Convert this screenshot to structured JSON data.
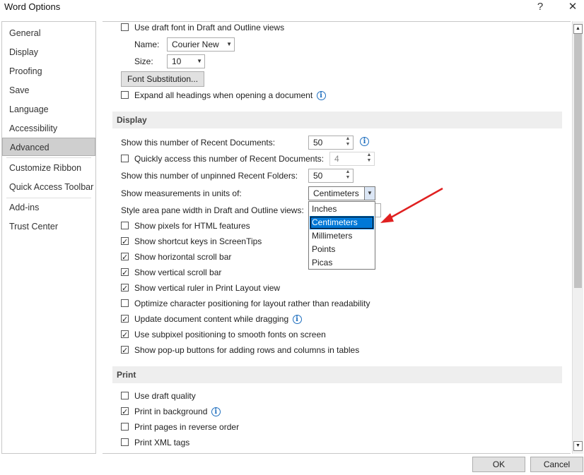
{
  "window": {
    "title": "Word Options",
    "help_label": "?",
    "close_label": "✕"
  },
  "sidebar": {
    "items": [
      {
        "label": "General"
      },
      {
        "label": "Display"
      },
      {
        "label": "Proofing"
      },
      {
        "label": "Save"
      },
      {
        "label": "Language"
      },
      {
        "label": "Accessibility"
      },
      {
        "label": "Advanced",
        "selected": true
      },
      {
        "label": "Customize Ribbon"
      },
      {
        "label": "Quick Access Toolbar"
      },
      {
        "label": "Add-ins"
      },
      {
        "label": "Trust Center"
      }
    ]
  },
  "top_options": {
    "draft_font_label": "Use draft font in Draft and Outline views",
    "name_label": "Name:",
    "name_value": "Courier New",
    "size_label": "Size:",
    "size_value": "10",
    "font_substitution_label": "Font Substitution...",
    "expand_headings_label": "Expand all headings when opening a document"
  },
  "display": {
    "header": "Display",
    "recent_docs_label": "Show this number of Recent Documents:",
    "recent_docs_value": "50",
    "quick_access_label": "Quickly access this number of Recent Documents:",
    "quick_access_value": "4",
    "unpinned_folders_label": "Show this number of unpinned Recent Folders:",
    "unpinned_folders_value": "50",
    "units_label": "Show measurements in units of:",
    "units_value": "Centimeters",
    "units_options": [
      "Inches",
      "Centimeters",
      "Millimeters",
      "Points",
      "Picas"
    ],
    "style_area_label": "Style area pane width in Draft and Outline views:",
    "checkboxes": [
      {
        "label": "Show pixels for HTML features",
        "checked": false
      },
      {
        "label": "Show shortcut keys in ScreenTips",
        "checked": true
      },
      {
        "label": "Show horizontal scroll bar",
        "checked": true
      },
      {
        "label": "Show vertical scroll bar",
        "checked": true
      },
      {
        "label": "Show vertical ruler in Print Layout view",
        "checked": true
      },
      {
        "label": "Optimize character positioning for layout rather than readability",
        "checked": false
      },
      {
        "label": "Update document content while dragging",
        "checked": true
      },
      {
        "label": "Use subpixel positioning to smooth fonts on screen",
        "checked": true
      },
      {
        "label": "Show pop-up buttons for adding rows and columns in tables",
        "checked": true
      }
    ]
  },
  "print": {
    "header": "Print",
    "checkboxes": [
      {
        "label": "Use draft quality",
        "checked": false
      },
      {
        "label": "Print in background",
        "checked": true
      },
      {
        "label": "Print pages in reverse order",
        "checked": false
      },
      {
        "label": "Print XML tags",
        "checked": false
      }
    ]
  },
  "footer": {
    "ok_label": "OK",
    "cancel_label": "Cancel"
  },
  "colors": {
    "selection": "#0078d7",
    "annotation_arrow": "#e02020",
    "info_icon": "#1f6fbf"
  }
}
